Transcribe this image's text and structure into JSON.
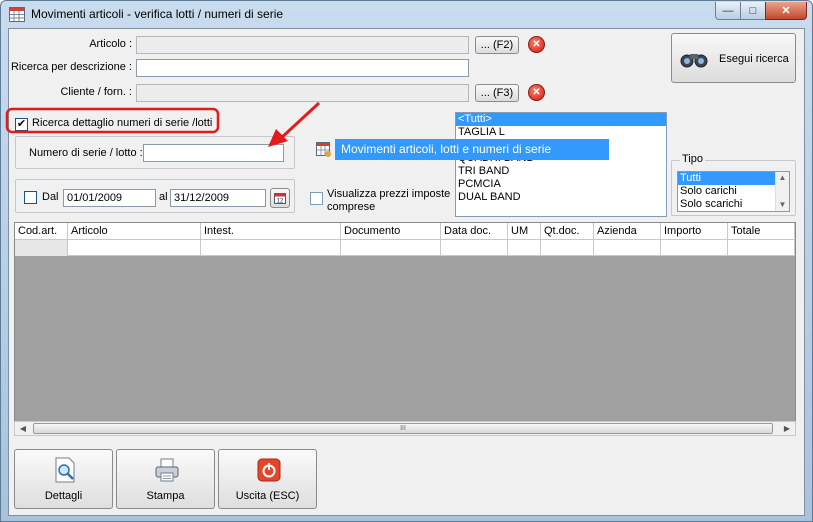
{
  "window": {
    "title": "Movimenti articoli - verifica lotti / numeri di serie",
    "minimize_glyph": "—",
    "maximize_glyph": "□",
    "close_glyph": "✕"
  },
  "form": {
    "articolo_label": "Articolo :",
    "articolo_value": "",
    "articolo_lookup": "... (F2)",
    "descrizione_label": "Ricerca per descrizione :",
    "descrizione_value": "",
    "cliente_label": "Cliente / forn. :",
    "cliente_value": "",
    "cliente_lookup": "... (F3)",
    "serial_search_label": "Ricerca dettaglio numeri di serie /lotti",
    "serial_search_checked": true,
    "serial_label": "Numero di serie / lotto :",
    "serial_value": "",
    "date_check_label": "Dal",
    "date_from": "01/01/2009",
    "date_to_label": "al",
    "date_to": "31/12/2009",
    "show_prices_label_1": "Visualizza prezzi imposte",
    "show_prices_label_2": "comprese",
    "search_button": "Esegui ricerca"
  },
  "category_list": {
    "items": [
      "<Tutti>",
      "TAGLIA L",
      "",
      "QUADRI BAND",
      "TRI BAND",
      "PCMCIA",
      "DUAL BAND"
    ],
    "selected_index": 0
  },
  "popup": {
    "text": "Movimenti articoli, lotti e numeri di serie"
  },
  "tipo": {
    "legend": "Tipo",
    "items": [
      "Tutti",
      "Solo carichi",
      "Solo scarichi"
    ],
    "selected_index": 0
  },
  "grid": {
    "columns": [
      "Cod.art.",
      "Articolo",
      "Intest.",
      "Documento",
      "Data doc.",
      "UM",
      "Qt.doc.",
      "Azienda",
      "Importo",
      "Totale"
    ],
    "thumb_grip": "III"
  },
  "toolbar": {
    "details": "Dettagli",
    "print": "Stampa",
    "exit": "Uscita (ESC)"
  },
  "colors": {
    "selection": "#3399ff",
    "annotation_red": "#e31b1b"
  }
}
